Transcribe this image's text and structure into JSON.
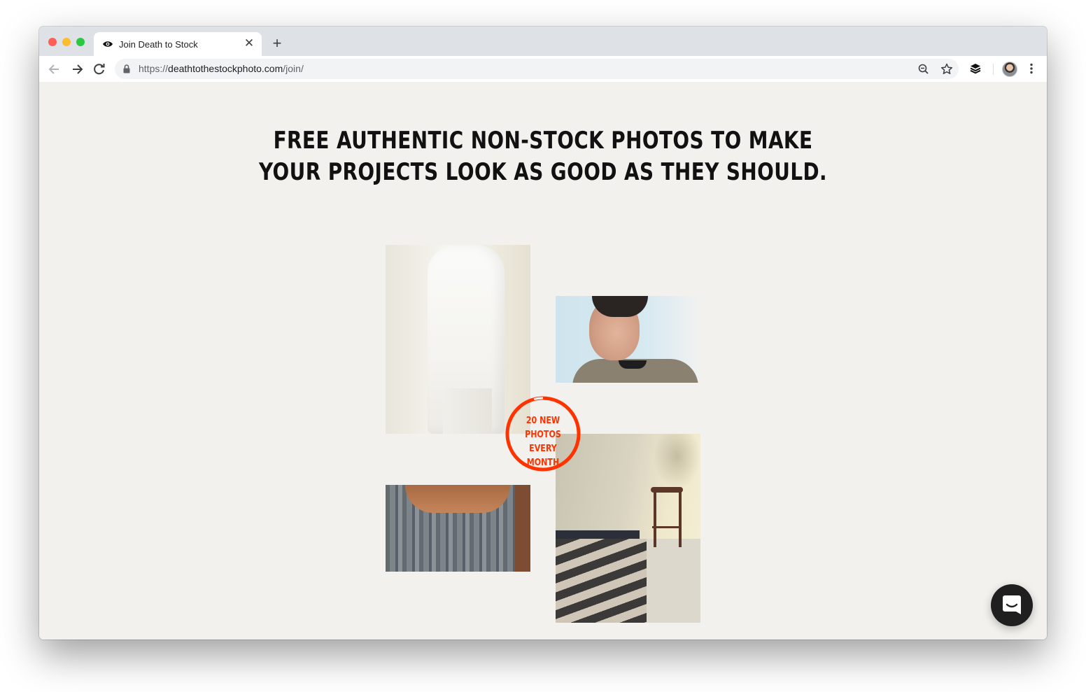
{
  "browser": {
    "tab": {
      "title": "Join Death to Stock",
      "favicon": "eye-icon",
      "close_symbol": "✕"
    },
    "new_tab_symbol": "+",
    "address_bar": {
      "scheme": "https://",
      "host": "deathtothestockphoto.com",
      "path": "/join/"
    },
    "icons": [
      "back-arrow-icon",
      "forward-arrow-icon",
      "reload-icon",
      "lock-icon",
      "zoom-out-icon",
      "star-icon",
      "layers-icon",
      "avatar",
      "kebab-menu-icon"
    ]
  },
  "page": {
    "headline": {
      "line1": "FREE AUTHENTIC NON-STOCK PHOTOS TO MAKE",
      "line2": "YOUR PROJECTS LOOK AS GOOD AS THEY SHOULD."
    },
    "badge": {
      "line1": "20 NEW",
      "line2": "PHOTOS EVERY",
      "line3": "MONTH",
      "color": "#ff3300"
    },
    "photos": [
      {
        "name": "photo-white-outfit",
        "subject": "person in white linen dress"
      },
      {
        "name": "photo-man-portrait",
        "subject": "young man looking down"
      },
      {
        "name": "photo-plaid-jacket",
        "subject": "person in plaid jacket"
      },
      {
        "name": "photo-bed-stool",
        "subject": "bed with striped blanket and wooden stool"
      }
    ],
    "chat_launcher_icon": "chat-smile-icon",
    "background_color": "#f2f1ed"
  }
}
